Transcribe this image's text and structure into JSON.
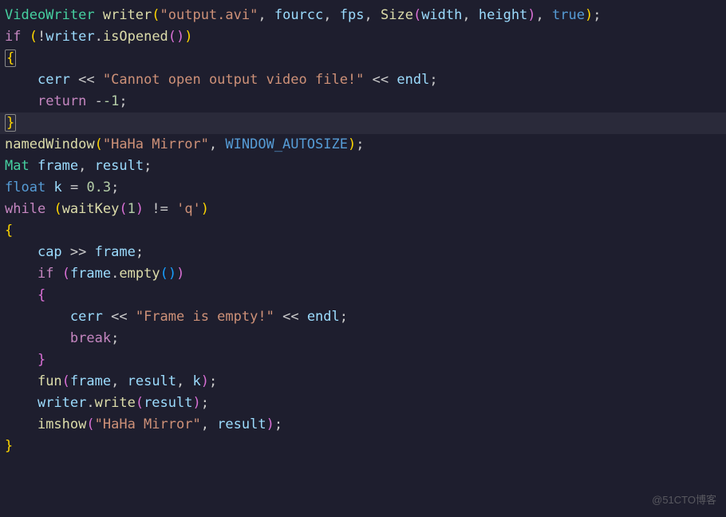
{
  "watermark": "@51CTO博客",
  "code": {
    "l1": {
      "type": "VideoWriter",
      "func": "writer",
      "str": "\"output.avi\"",
      "a2": "fourcc",
      "a3": "fps",
      "sizeType": "Size",
      "w": "width",
      "h": "height",
      "last": "true"
    },
    "l2": {
      "kw": "if",
      "neg": "!",
      "obj": "writer",
      "method": "isOpened"
    },
    "l3": {
      "brace": "{"
    },
    "l4": {
      "cerr": "cerr",
      "op": "<<",
      "str": "\"Cannot open output video file!\"",
      "endl": "endl"
    },
    "l5": {
      "kw": "return",
      "num": "-1"
    },
    "l6": {
      "brace": "}"
    },
    "l7": {
      "func": "namedWindow",
      "str": "\"HaHa Mirror\"",
      "const": "WINDOW_AUTOSIZE"
    },
    "l8": {
      "type": "Mat",
      "v1": "frame",
      "v2": "result"
    },
    "l9": {
      "type": "float",
      "v": "k",
      "num": "0.3"
    },
    "l10": {
      "kw": "while",
      "func": "waitKey",
      "arg": "1",
      "op": "!=",
      "chr": "'q'"
    },
    "l11": {
      "brace": "{"
    },
    "l12": {
      "cap": "cap",
      "op": ">>",
      "frame": "frame"
    },
    "l13": {
      "kw": "if",
      "obj": "frame",
      "method": "empty"
    },
    "l14": {
      "brace": "{"
    },
    "l15": {
      "cerr": "cerr",
      "op": "<<",
      "str": "\"Frame is empty!\"",
      "endl": "endl"
    },
    "l16": {
      "kw": "break"
    },
    "l17": {
      "brace": "}"
    },
    "l18": {
      "func": "fun",
      "a1": "frame",
      "a2": "result",
      "a3": "k"
    },
    "l19": {
      "obj": "writer",
      "method": "write",
      "arg": "result"
    },
    "l20": {
      "func": "imshow",
      "str": "\"HaHa Mirror\"",
      "arg": "result"
    },
    "l21": {
      "brace": "}"
    }
  }
}
